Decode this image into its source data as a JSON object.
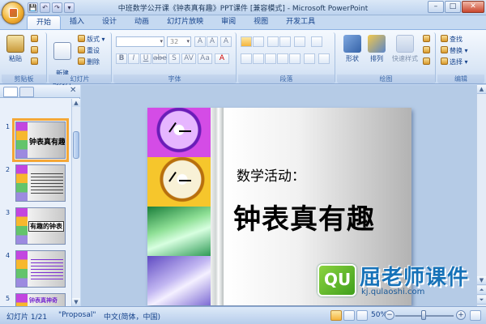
{
  "window": {
    "title": "中班数学公开课《钟表真有趣》PPT课件 [兼容模式] - Microsoft PowerPoint",
    "qat": [
      "💾",
      "↶",
      "↷",
      "▾"
    ],
    "controls": {
      "minimize": "–",
      "maximize": "□",
      "close": "✕"
    }
  },
  "tabs": [
    {
      "label": "开始",
      "active": true
    },
    {
      "label": "插入"
    },
    {
      "label": "设计"
    },
    {
      "label": "动画"
    },
    {
      "label": "幻灯片放映"
    },
    {
      "label": "审阅"
    },
    {
      "label": "视图"
    },
    {
      "label": "开发工具"
    }
  ],
  "ribbon": {
    "clipboard": {
      "label": "剪贴板",
      "paste": "粘贴"
    },
    "slides": {
      "label": "幻灯片",
      "new_slide": "新建\n幻灯片",
      "layout": "版式",
      "reset": "重设",
      "delete": "删除"
    },
    "font": {
      "label": "字体",
      "font_name": "",
      "font_size": "32",
      "bold": "B",
      "italic": "I",
      "underline": "U",
      "strike": "abe",
      "shadow": "S",
      "spacing": "AV",
      "case": "Aa",
      "color": "A",
      "grow": "A",
      "shrink": "A",
      "clear": "A"
    },
    "paragraph": {
      "label": "段落"
    },
    "drawing": {
      "label": "绘图",
      "shapes": "形状",
      "arrange": "排列",
      "quick_styles": "快速样式"
    },
    "editing": {
      "label": "编辑",
      "find": "查找",
      "replace": "替换",
      "select": "选择"
    }
  },
  "thumbnails": [
    {
      "num": "1",
      "text": "钟表真有趣",
      "selected": true
    },
    {
      "num": "2",
      "text": ""
    },
    {
      "num": "3",
      "text": "有趣的钟表"
    },
    {
      "num": "4",
      "text": ""
    },
    {
      "num": "5",
      "text": "钟表真神奇"
    }
  ],
  "slide": {
    "subtitle": "数学活动：",
    "title": "钟表真有趣"
  },
  "watermark": {
    "badge": "QU",
    "name": "屈老师课件",
    "url": "kj.qulaoshi.com"
  },
  "status": {
    "slide_count": "幻灯片 1/21",
    "theme": "\"Proposal\"",
    "language": "中文(简体，中国)",
    "zoom": "50%",
    "zoom_out": "−",
    "zoom_in": "+"
  },
  "colors": {
    "accent": "#15428b",
    "ribbon": "#dbe7f6",
    "selection": "#f4a736"
  }
}
